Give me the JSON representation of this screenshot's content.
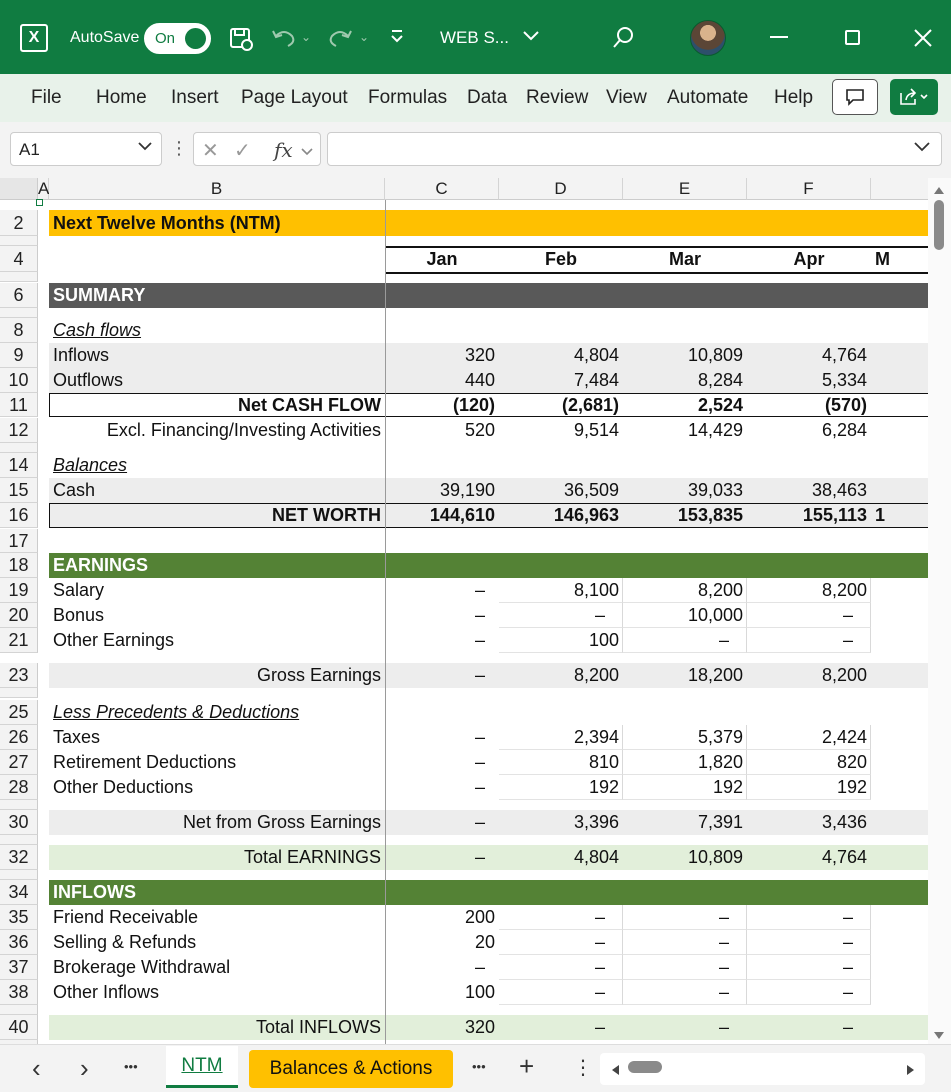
{
  "titlebar": {
    "app_icon_glyph": "X",
    "autosave_label": "AutoSave",
    "autosave_state": "On",
    "filename": "WEB S...",
    "icons": [
      "excel-app-icon",
      "save-icon",
      "undo-icon",
      "redo-icon",
      "customize-qat-icon",
      "chevron-down-icon",
      "search-icon",
      "avatar",
      "minimize-icon",
      "maximize-icon",
      "close-icon"
    ]
  },
  "ribbon": {
    "tabs": [
      "File",
      "Home",
      "Insert",
      "Page Layout",
      "Formulas",
      "Data",
      "Review",
      "View",
      "Automate",
      "Help"
    ]
  },
  "formula_bar": {
    "name_box": "A1",
    "fx_label": "fx",
    "formula_value": ""
  },
  "columns": [
    "A",
    "B",
    "C",
    "D",
    "E",
    "F"
  ],
  "rows": [
    {
      "n": "2",
      "cells": {
        "B": "Next Twelve Months (NTM)"
      }
    },
    {
      "n": "4",
      "cells": {
        "C": "Jan",
        "D": "Feb",
        "E": "Mar",
        "F": "Apr",
        "G": "M"
      }
    },
    {
      "n": "6",
      "cells": {
        "B": "SUMMARY"
      }
    },
    {
      "n": "8",
      "cells": {
        "B": "Cash flows"
      }
    },
    {
      "n": "9",
      "cells": {
        "B": "Inflows",
        "C": "320",
        "D": "4,804",
        "E": "10,809",
        "F": "4,764"
      }
    },
    {
      "n": "10",
      "cells": {
        "B": "Outflows",
        "C": "440",
        "D": "7,484",
        "E": "8,284",
        "F": "5,334"
      }
    },
    {
      "n": "11",
      "cells": {
        "B": "Net CASH FLOW",
        "C": "(120)",
        "D": "(2,681)",
        "E": "2,524",
        "F": "(570)"
      }
    },
    {
      "n": "12",
      "cells": {
        "B": "Excl. Financing/Investing Activities",
        "C": "520",
        "D": "9,514",
        "E": "14,429",
        "F": "6,284"
      }
    },
    {
      "n": "14",
      "cells": {
        "B": "Balances"
      }
    },
    {
      "n": "15",
      "cells": {
        "B": "Cash",
        "C": "39,190",
        "D": "36,509",
        "E": "39,033",
        "F": "38,463"
      }
    },
    {
      "n": "16",
      "cells": {
        "B": "NET WORTH",
        "C": "144,610",
        "D": "146,963",
        "E": "153,835",
        "F": "155,113",
        "G": "1"
      }
    },
    {
      "n": "17",
      "cells": {}
    },
    {
      "n": "18",
      "cells": {
        "B": "EARNINGS"
      }
    },
    {
      "n": "19",
      "cells": {
        "B": "Salary",
        "C": "–",
        "D": "8,100",
        "E": "8,200",
        "F": "8,200"
      }
    },
    {
      "n": "20",
      "cells": {
        "B": "Bonus",
        "C": "–",
        "D": "–",
        "E": "10,000",
        "F": "–"
      }
    },
    {
      "n": "21",
      "cells": {
        "B": "Other Earnings",
        "C": "–",
        "D": "100",
        "E": "–",
        "F": "–"
      }
    },
    {
      "n": "23",
      "cells": {
        "B": "Gross Earnings",
        "C": "–",
        "D": "8,200",
        "E": "18,200",
        "F": "8,200"
      }
    },
    {
      "n": "25",
      "cells": {
        "B": "Less Precedents & Deductions"
      }
    },
    {
      "n": "26",
      "cells": {
        "B": "Taxes",
        "C": "–",
        "D": "2,394",
        "E": "5,379",
        "F": "2,424"
      }
    },
    {
      "n": "27",
      "cells": {
        "B": "Retirement Deductions",
        "C": "–",
        "D": "810",
        "E": "1,820",
        "F": "820"
      }
    },
    {
      "n": "28",
      "cells": {
        "B": "Other Deductions",
        "C": "–",
        "D": "192",
        "E": "192",
        "F": "192"
      }
    },
    {
      "n": "30",
      "cells": {
        "B": "Net from Gross Earnings",
        "C": "–",
        "D": "3,396",
        "E": "7,391",
        "F": "3,436"
      }
    },
    {
      "n": "32",
      "cells": {
        "B": "Total EARNINGS",
        "C": "–",
        "D": "4,804",
        "E": "10,809",
        "F": "4,764"
      }
    },
    {
      "n": "34",
      "cells": {
        "B": "INFLOWS"
      }
    },
    {
      "n": "35",
      "cells": {
        "B": "Friend Receivable",
        "C": "200",
        "D": "–",
        "E": "–",
        "F": "–"
      }
    },
    {
      "n": "36",
      "cells": {
        "B": "Selling & Refunds",
        "C": "20",
        "D": "–",
        "E": "–",
        "F": "–"
      }
    },
    {
      "n": "37",
      "cells": {
        "B": "Brokerage Withdrawal",
        "C": "–",
        "D": "–",
        "E": "–",
        "F": "–"
      }
    },
    {
      "n": "38",
      "cells": {
        "B": "Other Inflows",
        "C": "100",
        "D": "–",
        "E": "–",
        "F": "–"
      }
    },
    {
      "n": "40",
      "cells": {
        "B": "Total INFLOWS",
        "C": "320",
        "D": "–",
        "E": "–",
        "F": "–"
      }
    }
  ],
  "sheet_tabs": {
    "nav_prev": "‹",
    "nav_next": "›",
    "more_left": "•••",
    "active": "NTM",
    "other": "Balances & Actions",
    "more_right": "•••",
    "add": "+",
    "options": "⋮"
  },
  "colors": {
    "excel_green": "#107c41",
    "header_yellow": "#ffc000",
    "summary_gray": "#595959",
    "section_green": "#548235",
    "light_gray_band": "#ededed",
    "light_green_band": "#e2efda"
  }
}
